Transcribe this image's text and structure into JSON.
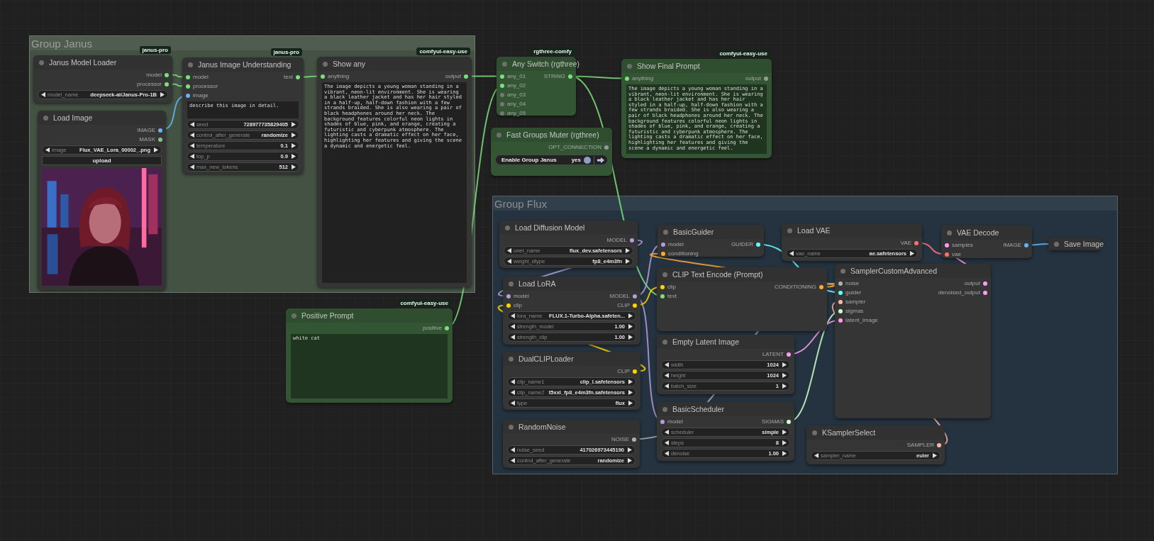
{
  "groups": [
    {
      "title": "Group Janus",
      "color": "#445244"
    },
    {
      "title": "Group Flux",
      "color": "#24333f"
    }
  ],
  "nodes": [
    {
      "kind": "node",
      "title": "Janus Model Loader",
      "badge": "janus-pro",
      "color": "#353535",
      "outputs": [
        {
          "label": "model",
          "color": "#7be07b"
        },
        {
          "label": "processor",
          "color": "#7be07b"
        }
      ],
      "widgets": [
        {
          "kind": "combo",
          "name": "model_name",
          "value": "deepseek-ai/Janus-Pro-1B"
        }
      ]
    },
    {
      "kind": "node",
      "title": "Load Image",
      "color": "#353535",
      "outputs": [
        {
          "label": "IMAGE",
          "color": "#64b5f6"
        },
        {
          "label": "MASK",
          "color": "#81c784"
        }
      ],
      "widgets": [
        {
          "kind": "combo",
          "name": "image",
          "value": "Flux_VAE_Lora_00002_.png"
        },
        {
          "kind": "button",
          "label": "upload"
        },
        {
          "kind": "picture"
        }
      ]
    },
    {
      "kind": "node",
      "title": "Janus Image Understanding",
      "badge": "janus-pro",
      "color": "#353535",
      "inputs": [
        {
          "label": "model",
          "color": "#7be07b"
        },
        {
          "label": "processor",
          "color": "#7be07b"
        },
        {
          "label": "image",
          "color": "#64b5f6"
        }
      ],
      "outputs": [
        {
          "label": "text",
          "color": "#7be07b"
        }
      ],
      "widgets": [
        {
          "kind": "text",
          "text": "describe this image in detail."
        },
        {
          "kind": "combo",
          "name": "seed",
          "value": "728977735829405"
        },
        {
          "kind": "combo",
          "name": "control_after_generate",
          "value": "randomize"
        },
        {
          "kind": "combo",
          "name": "temperature",
          "value": "0.1"
        },
        {
          "kind": "combo",
          "name": "top_p",
          "value": "0.9"
        },
        {
          "kind": "combo",
          "name": "max_new_tokens",
          "value": "512"
        }
      ]
    },
    {
      "kind": "node",
      "title": "Show any",
      "badge": "comfyui-easy-use",
      "color": "#353535",
      "inputs": [
        {
          "label": "anything",
          "color": "#7be07b"
        }
      ],
      "outputs": [
        {
          "label": "output",
          "color": "#7be07b"
        }
      ],
      "widgets": [
        {
          "kind": "text",
          "text": "The image depicts a young woman standing in a vibrant, neon-lit environment. She is wearing a black leather jacket and has her hair styled in a half-up, half-down fashion with a few strands braided. She is also wearing a pair of black headphones around her neck. The background features colorful neon lights in shades of blue, pink, and orange, creating a futuristic and cyberpunk atmosphere. The lighting casts a dramatic effect on her face, highlighting her features and giving the scene a dynamic and energetic feel."
        }
      ]
    },
    {
      "kind": "node",
      "title": "Any Switch (rgthree)",
      "badge": "rgthree-comfy",
      "color": "#335533",
      "inputs": [
        {
          "label": "any_01",
          "color": "#7be07b"
        },
        {
          "label": "any_02",
          "color": "#7be07b"
        },
        {
          "label": "any_03",
          "color": "#777777"
        },
        {
          "label": "any_04",
          "color": "#777777"
        },
        {
          "label": "any_05",
          "color": "#777777"
        }
      ],
      "outputs": [
        {
          "label": "STRING",
          "color": "#7be07b"
        }
      ]
    },
    {
      "kind": "node",
      "title": "Show Final Prompt",
      "badge": "comfyui-easy-use",
      "color": "#335533",
      "inputs": [
        {
          "label": "anything",
          "color": "#7be07b"
        }
      ],
      "outputs": [
        {
          "label": "output",
          "color": "#999999"
        }
      ],
      "widgets": [
        {
          "kind": "text",
          "text": "The image depicts a young woman standing in a vibrant, neon-lit environment. She is wearing a black leather jacket and has her hair styled in a half-up, half-down fashion with a few strands braided. She is also wearing a pair of black headphones around her neck. The background features colorful neon lights in shades of blue, pink, and orange, creating a futuristic and cyberpunk atmosphere. The lighting casts a dramatic effect on her face, highlighting her features and giving the scene a dynamic and energetic feel."
        }
      ]
    },
    {
      "kind": "node",
      "title": "Fast Groups Muter (rgthree)",
      "color": "#335533",
      "outputs": [
        {
          "label": "OPT_CONNECTION",
          "color": "#999999"
        }
      ],
      "widgets": [
        {
          "kind": "toggle",
          "label": "Enable Group Janus",
          "value": "yes",
          "on": true
        }
      ]
    },
    {
      "kind": "node",
      "title": "Positive Prompt",
      "badge": "comfyui-easy-use",
      "color": "#335533",
      "outputs": [
        {
          "label": "positive",
          "color": "#7be07b"
        }
      ],
      "widgets": [
        {
          "kind": "text",
          "text": "white cat"
        }
      ]
    },
    {
      "kind": "node",
      "title": "Load Diffusion Model",
      "color": "#353535",
      "outputs": [
        {
          "label": "MODEL",
          "color": "#b39ddb"
        }
      ],
      "widgets": [
        {
          "kind": "combo",
          "name": "unet_name",
          "value": "flux_dev.safetensors"
        },
        {
          "kind": "combo",
          "name": "weight_dtype",
          "value": "fp8_e4m3fn"
        }
      ]
    },
    {
      "kind": "node",
      "title": "Load LoRA",
      "color": "#353535",
      "inputs": [
        {
          "label": "model",
          "color": "#b39ddb"
        },
        {
          "label": "clip",
          "color": "#ffd500"
        }
      ],
      "outputs": [
        {
          "label": "MODEL",
          "color": "#b39ddb"
        },
        {
          "label": "CLIP",
          "color": "#ffd500"
        }
      ],
      "widgets": [
        {
          "kind": "combo",
          "name": "lora_name",
          "value": "FLUX.1-Turbo-Alpha.safeten..."
        },
        {
          "kind": "combo",
          "name": "strength_model",
          "value": "1.00"
        },
        {
          "kind": "combo",
          "name": "strength_clip",
          "value": "1.00"
        }
      ]
    },
    {
      "kind": "node",
      "title": "DualCLIPLoader",
      "color": "#353535",
      "outputs": [
        {
          "label": "CLIP",
          "color": "#ffd500"
        }
      ],
      "widgets": [
        {
          "kind": "combo",
          "name": "clip_name1",
          "value": "clip_l.safetensors"
        },
        {
          "kind": "combo",
          "name": "clip_name2",
          "value": "t5xxl_fp8_e4m3fn.safetensors"
        },
        {
          "kind": "combo",
          "name": "type",
          "value": "flux"
        }
      ]
    },
    {
      "kind": "node",
      "title": "RandomNoise",
      "color": "#353535",
      "outputs": [
        {
          "label": "NOISE",
          "color": "#b0b0b0"
        }
      ],
      "widgets": [
        {
          "kind": "combo",
          "name": "noise_seed",
          "value": "417026973445190"
        },
        {
          "kind": "combo",
          "name": "control_after_generate",
          "value": "randomize"
        }
      ]
    },
    {
      "kind": "node",
      "title": "BasicGuider",
      "color": "#353535",
      "inputs": [
        {
          "label": "model",
          "color": "#b39ddb"
        },
        {
          "label": "conditioning",
          "color": "#ffa931"
        }
      ],
      "outputs": [
        {
          "label": "GUIDER",
          "color": "#66ffff"
        }
      ]
    },
    {
      "kind": "node",
      "title": "CLIP Text Encode (Prompt)",
      "color": "#353535",
      "inputs": [
        {
          "label": "clip",
          "color": "#ffd500"
        },
        {
          "label": "text",
          "color": "#7be07b"
        }
      ],
      "outputs": [
        {
          "label": "CONDITIONING",
          "color": "#ffa931"
        }
      ]
    },
    {
      "kind": "node",
      "title": "Empty Latent Image",
      "color": "#353535",
      "outputs": [
        {
          "label": "LATENT",
          "color": "#ff9cf9"
        }
      ],
      "widgets": [
        {
          "kind": "combo",
          "name": "width",
          "value": "1024"
        },
        {
          "kind": "combo",
          "name": "height",
          "value": "1024"
        },
        {
          "kind": "combo",
          "name": "batch_size",
          "value": "1"
        }
      ]
    },
    {
      "kind": "node",
      "title": "BasicScheduler",
      "color": "#353535",
      "inputs": [
        {
          "label": "model",
          "color": "#b39ddb"
        }
      ],
      "outputs": [
        {
          "label": "SIGMAS",
          "color": "#cdffcd"
        }
      ],
      "widgets": [
        {
          "kind": "combo",
          "name": "scheduler",
          "value": "simple"
        },
        {
          "kind": "combo",
          "name": "steps",
          "value": "8"
        },
        {
          "kind": "combo",
          "name": "denoise",
          "value": "1.00"
        }
      ]
    },
    {
      "kind": "node",
      "title": "Load VAE",
      "color": "#353535",
      "outputs": [
        {
          "label": "VAE",
          "color": "#ff6e6e"
        }
      ],
      "widgets": [
        {
          "kind": "combo",
          "name": "vae_name",
          "value": "ae.safetensors"
        }
      ]
    },
    {
      "kind": "node",
      "title": "VAE Decode",
      "color": "#353535",
      "inputs": [
        {
          "label": "samples",
          "color": "#ff9cf9"
        },
        {
          "label": "vae",
          "color": "#ff6e6e"
        }
      ],
      "outputs": [
        {
          "label": "IMAGE",
          "color": "#64b5f6"
        }
      ]
    },
    {
      "kind": "collapsed",
      "title": "Save Image",
      "color": "#353535"
    },
    {
      "kind": "node",
      "title": "SamplerCustomAdvanced",
      "color": "#353535",
      "inputs": [
        {
          "label": "noise",
          "color": "#b0b0b0"
        },
        {
          "label": "guider",
          "color": "#66ffff"
        },
        {
          "label": "sampler",
          "color": "#ffb8a8"
        },
        {
          "label": "sigmas",
          "color": "#cdffcd"
        },
        {
          "label": "latent_image",
          "color": "#ff9cf9"
        }
      ],
      "outputs": [
        {
          "label": "output",
          "color": "#ff9cf9"
        },
        {
          "label": "denoised_output",
          "color": "#ff9cf9"
        }
      ]
    },
    {
      "kind": "node",
      "title": "KSamplerSelect",
      "color": "#353535",
      "outputs": [
        {
          "label": "SAMPLER",
          "color": "#ffb8a8"
        }
      ],
      "widgets": [
        {
          "kind": "combo",
          "name": "sampler_name",
          "value": "euler"
        }
      ]
    }
  ]
}
